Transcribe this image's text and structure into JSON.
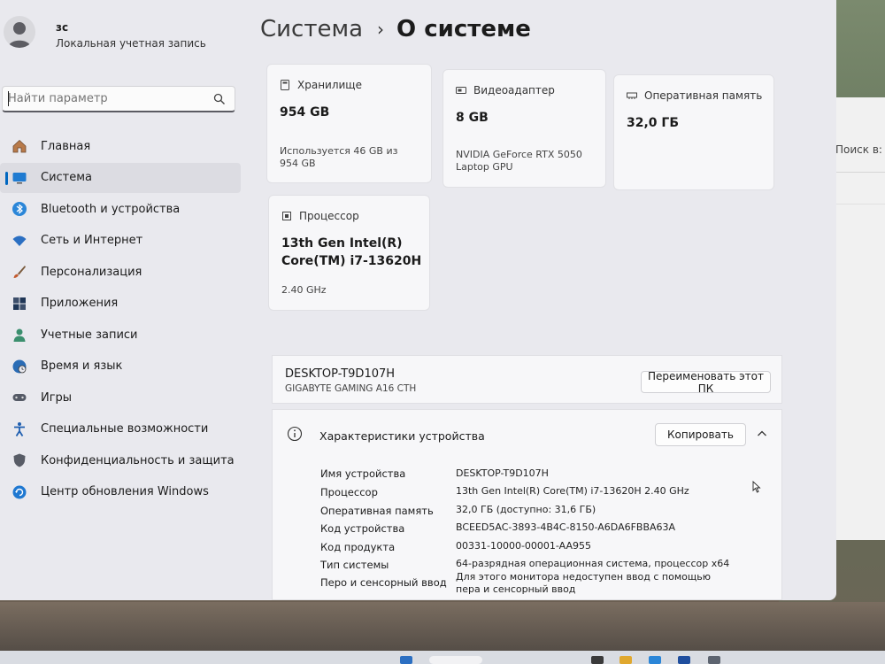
{
  "user": {
    "name": "зс",
    "account_type": "Локальная учетная запись"
  },
  "search": {
    "placeholder": "Найти параметр"
  },
  "sidebar": {
    "items": [
      {
        "label": "Главная",
        "icon": "home-icon",
        "selected": false
      },
      {
        "label": "Система",
        "icon": "system-icon",
        "selected": true
      },
      {
        "label": "Bluetooth и устройства",
        "icon": "bluetooth-icon",
        "selected": false
      },
      {
        "label": "Сеть и Интернет",
        "icon": "wifi-icon",
        "selected": false
      },
      {
        "label": "Персонализация",
        "icon": "brush-icon",
        "selected": false
      },
      {
        "label": "Приложения",
        "icon": "apps-icon",
        "selected": false
      },
      {
        "label": "Учетные записи",
        "icon": "person-icon",
        "selected": false
      },
      {
        "label": "Время и язык",
        "icon": "globe-clock-icon",
        "selected": false
      },
      {
        "label": "Игры",
        "icon": "gamepad-icon",
        "selected": false
      },
      {
        "label": "Специальные возможности",
        "icon": "accessibility-icon",
        "selected": false
      },
      {
        "label": "Конфиденциальность и защита",
        "icon": "shield-icon",
        "selected": false
      },
      {
        "label": "Центр обновления Windows",
        "icon": "update-icon",
        "selected": false
      }
    ]
  },
  "breadcrumb": {
    "parent": "Система",
    "separator": "›",
    "current": "О системе"
  },
  "cards": {
    "storage": {
      "title": "Хранилище",
      "value": "954 GB",
      "detail": "Используется 46 GB из 954 GB"
    },
    "gpu": {
      "title": "Видеоадаптер",
      "value": "8 GB",
      "detail": "NVIDIA GeForce RTX 5050 Laptop GPU"
    },
    "ram": {
      "title": "Оперативная память",
      "value": "32,0 ГБ"
    },
    "cpu": {
      "title": "Процессор",
      "value": "13th Gen Intel(R) Core(TM) i7-13620H",
      "detail": "2.40 GHz"
    }
  },
  "device": {
    "name": "DESKTOP-T9D107H",
    "model": "GIGABYTE GAMING A16 CTH",
    "rename_label": "Переименовать этот ПК"
  },
  "specs": {
    "title": "Характеристики устройства",
    "copy_label": "Копировать",
    "rows": [
      {
        "label": "Имя устройства",
        "value": "DESKTOP-T9D107H"
      },
      {
        "label": "Процессор",
        "value": "13th Gen Intel(R) Core(TM) i7-13620H   2.40 GHz"
      },
      {
        "label": "Оперативная память",
        "value": "32,0 ГБ (доступно: 31,6 ГБ)"
      },
      {
        "label": "Код устройства",
        "value": "BCEED5AC-3893-4B4C-8150-A6DA6FBBA63A"
      },
      {
        "label": "Код продукта",
        "value": "00331-10000-00001-AA955"
      },
      {
        "label": "Тип системы",
        "value": "64-разрядная операционная система, процессор x64"
      },
      {
        "label": "Перо и сенсорный ввод",
        "value": "Для этого монитора недоступен ввод с помощью пера и сенсорный ввод"
      }
    ]
  },
  "background_window": {
    "search_text": "Поиск в: Э"
  },
  "colors": {
    "accent": "#0067c0",
    "window_bg": "#e9e9ee",
    "card_bg": "#f7f7f9"
  }
}
